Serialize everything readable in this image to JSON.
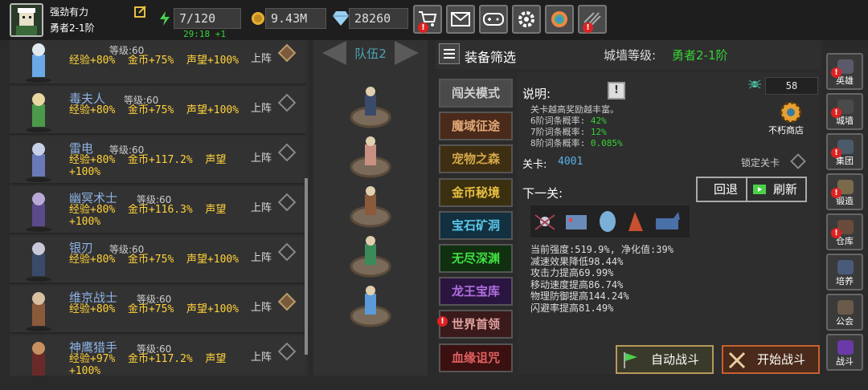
{
  "player": {
    "name": "强劲有力",
    "rank": "勇者2-1阶"
  },
  "resources": {
    "stamina": "7/120",
    "timer": "29:18 +1",
    "gold": "9.43M",
    "gems": "28260"
  },
  "top_icons": [
    "cart-icon",
    "mail-icon",
    "gamepad-icon",
    "gear-icon",
    "camera-icon",
    "chart-icon"
  ],
  "heroes": [
    {
      "name": "",
      "level": "等级:60",
      "exp": "经验+80%",
      "gold": "金币+75%",
      "fame": "声望+100%",
      "action": "上阵",
      "deployed": true
    },
    {
      "name": "毒夫人",
      "level": "等级:60",
      "exp": "经验+80%",
      "gold": "金币+75%",
      "fame": "声望+100%",
      "action": "上阵",
      "deployed": false
    },
    {
      "name": "雷电",
      "level": "等级:60",
      "exp": "经验+80%",
      "gold": "金币+117.2%",
      "fame": "声望",
      "fame2": "+100%",
      "action": "上阵",
      "deployed": false
    },
    {
      "name": "幽冥术士",
      "level": "等级:60",
      "exp": "经验+80%",
      "gold": "金币+116.3%",
      "fame": "声望",
      "fame2": "+100%",
      "action": "上阵",
      "deployed": false
    },
    {
      "name": "银刃",
      "level": "等级:60",
      "exp": "经验+80%",
      "gold": "金币+75%",
      "fame": "声望+100%",
      "action": "上阵",
      "deployed": false
    },
    {
      "name": "维京战士",
      "level": "等级:60",
      "exp": "经验+80%",
      "gold": "金币+75%",
      "fame": "声望+100%",
      "action": "上阵",
      "deployed": true
    },
    {
      "name": "神鹰猎手",
      "level": "等级:60",
      "exp": "经验+97%",
      "gold": "金币+117.2%",
      "fame": "声望",
      "fame2": "+100%",
      "action": "上阵",
      "deployed": false
    }
  ],
  "team": {
    "label": "队伍2"
  },
  "panel": {
    "filter_label": "装备筛选",
    "wall_label": "城墙等级:",
    "wall_value": "勇者2-1阶",
    "desc_label": "说明:",
    "desc_line1": "关卡越高奖励越丰富。",
    "rate6_label": "6阶词条概率:",
    "rate6": "42%",
    "rate7_label": "7阶词条概率:",
    "rate7": "12%",
    "rate8_label": "8阶词条概率:",
    "rate8": "0.085%",
    "stage_label": "关卡:",
    "stage_value": "4001",
    "lock_label": "锁定关卡",
    "next_label": "下一关:",
    "back_button": "回退",
    "refresh_button": "刷新",
    "key_count": "58",
    "shop_label": "不朽商店",
    "enemy_stats": [
      "当前强度:519.9%, 净化值:39%",
      "减速效果降低98.44%",
      "攻击力提高69.99%",
      "移动速度提高86.74%",
      "物理防御提高144.24%",
      "闪避率提高81.49%"
    ],
    "auto_battle": "自动战斗",
    "start_battle": "开始战斗"
  },
  "modes": [
    {
      "label": "闯关模式",
      "color": "#d0d0d0",
      "bg": "#4a4a4a"
    },
    {
      "label": "魔域征途",
      "color": "#e0a878",
      "bg": "#4a2a1a"
    },
    {
      "label": "宠物之森",
      "color": "#d4a848",
      "bg": "#3e2e12"
    },
    {
      "label": "金币秘境",
      "color": "#e8c040",
      "bg": "#3a3010"
    },
    {
      "label": "宝石矿洞",
      "color": "#5ac8e8",
      "bg": "#123040"
    },
    {
      "label": "无尽深渊",
      "color": "#40e040",
      "bg": "#103010"
    },
    {
      "label": "龙王宝库",
      "color": "#b070e0",
      "bg": "#2a1440"
    },
    {
      "label": "世界首领",
      "color": "#e0a0a0",
      "bg": "#3a1a1a"
    },
    {
      "label": "血缘诅咒",
      "color": "#e06060",
      "bg": "#3a1010"
    }
  ],
  "sidebar": [
    "英雄",
    "城墙",
    "集团",
    "锻造",
    "仓库",
    "培养",
    "公会",
    "战斗"
  ]
}
